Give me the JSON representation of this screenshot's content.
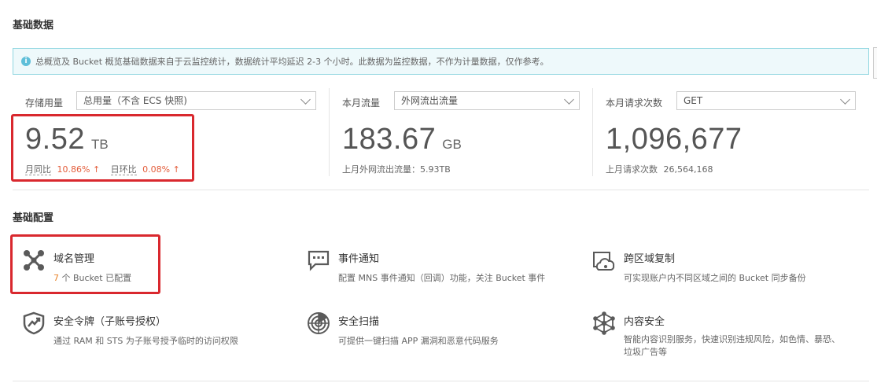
{
  "sections": {
    "basic_data_title": "基础数据",
    "basic_config_title": "基础配置"
  },
  "notice": {
    "icon": "info-icon",
    "text": "总概览及 Bucket 概览基础数据来自于云监控统计，数据统计平均延迟 2-3 个小时。此数据为监控数据，不作为计量数据，仅作参考。"
  },
  "metrics": {
    "storage": {
      "label": "存储用量",
      "select": "总用量（不含 ECS 快照)",
      "value": "9.52",
      "unit": "TB",
      "yoy_label": "月同比",
      "yoy_value": "10.86%",
      "dod_label": "日环比",
      "dod_value": "0.08%",
      "arrow": "↑"
    },
    "traffic": {
      "label": "本月流量",
      "select": "外网流出流量",
      "value": "183.67",
      "unit": "GB",
      "sub": "上月外网流出流量：5.93TB"
    },
    "requests": {
      "label": "本月请求次数",
      "select": "GET",
      "value": "1,096,677",
      "sub_label": "上月请求次数",
      "sub_value": "26,564,168"
    }
  },
  "features": [
    {
      "title": "域名管理",
      "count": "7",
      "desc": "个 Bucket 已配置",
      "icon": "domain-network-icon"
    },
    {
      "title": "事件通知",
      "desc": "配置 MNS 事件通知（回调）功能，关注 Bucket 事件",
      "icon": "message-icon"
    },
    {
      "title": "跨区域复制",
      "desc": "可实现账户内不同区域之间的 Bucket 同步备份",
      "icon": "cloud-replication-icon"
    },
    {
      "title": "安全令牌（子账号授权）",
      "desc": "通过 RAM 和 STS 为子账号授予临时的访问权限",
      "icon": "shield-icon"
    },
    {
      "title": "安全扫描",
      "desc": "可提供一键扫描 APP 漏洞和恶意代码服务",
      "icon": "radar-icon"
    },
    {
      "title": "内容安全",
      "desc": "智能内容识别服务，快速识别违规风险，如色情、暴恐、垃圾广告等",
      "icon": "content-network-icon"
    }
  ],
  "colors": {
    "highlight": "#d9282e",
    "up": "#e35d3b",
    "notice_bg": "#eef9fb",
    "notice_border": "#8fd6e0"
  }
}
